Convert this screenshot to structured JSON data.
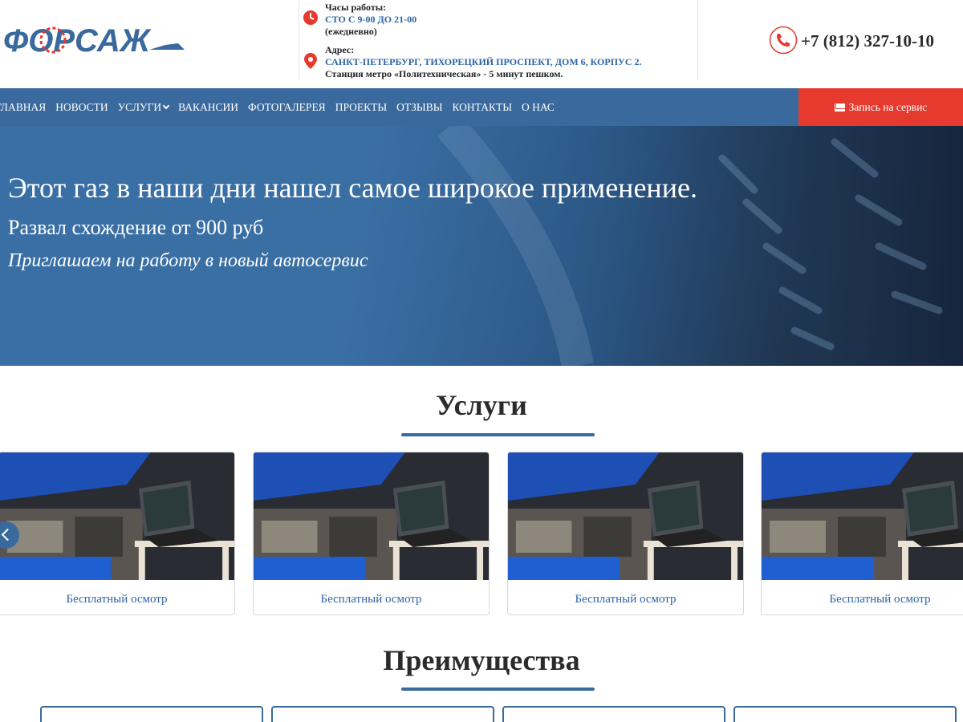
{
  "header": {
    "logo_text": "ФОРСАЖ",
    "hours": {
      "label": "Часы работы:",
      "value": "СТО С 9-00 ДО 21-00",
      "note": "(ежедневно)"
    },
    "address": {
      "label": "Адрес:",
      "value": "САНКТ-ПЕТЕРБУРГ, ТИХОРЕЦКИЙ ПРОСПЕКТ, ДОМ 6, КОРПУС 2.",
      "note": "Станция метро «Политехническая» - 5 минут пешком."
    },
    "phone": "+7 (812) 327-10-10"
  },
  "nav": {
    "items": [
      {
        "label": "Главная"
      },
      {
        "label": "Новости"
      },
      {
        "label": "Услуги"
      },
      {
        "label": "Вакансии"
      },
      {
        "label": "Фотогалерея"
      },
      {
        "label": "Проекты"
      },
      {
        "label": "Отзывы"
      },
      {
        "label": "Контакты"
      },
      {
        "label": "О нас"
      }
    ],
    "cta_label": "Запись на сервис"
  },
  "hero": {
    "headline": "Этот газ в наши дни нашел самое широкое применение.",
    "line2": "Развал схождение от 900 руб",
    "line3": "Приглашаем на работу в новый автосервис"
  },
  "services": {
    "title": "Услуги",
    "cards": [
      {
        "caption": "Бесплатный осмотр"
      },
      {
        "caption": "Бесплатный осмотр"
      },
      {
        "caption": "Бесплатный осмотр"
      },
      {
        "caption": "Бесплатный осмотр"
      }
    ]
  },
  "advantages": {
    "title": "Преимущества"
  },
  "colors": {
    "brand_blue": "#3a6a9d",
    "accent_red": "#e63a2e",
    "link_blue": "#2c64a4"
  },
  "icons": [
    "clock-icon",
    "location-pin-icon",
    "phone-icon",
    "envelope-icon",
    "chevron-down-icon",
    "arrow-left-icon"
  ]
}
